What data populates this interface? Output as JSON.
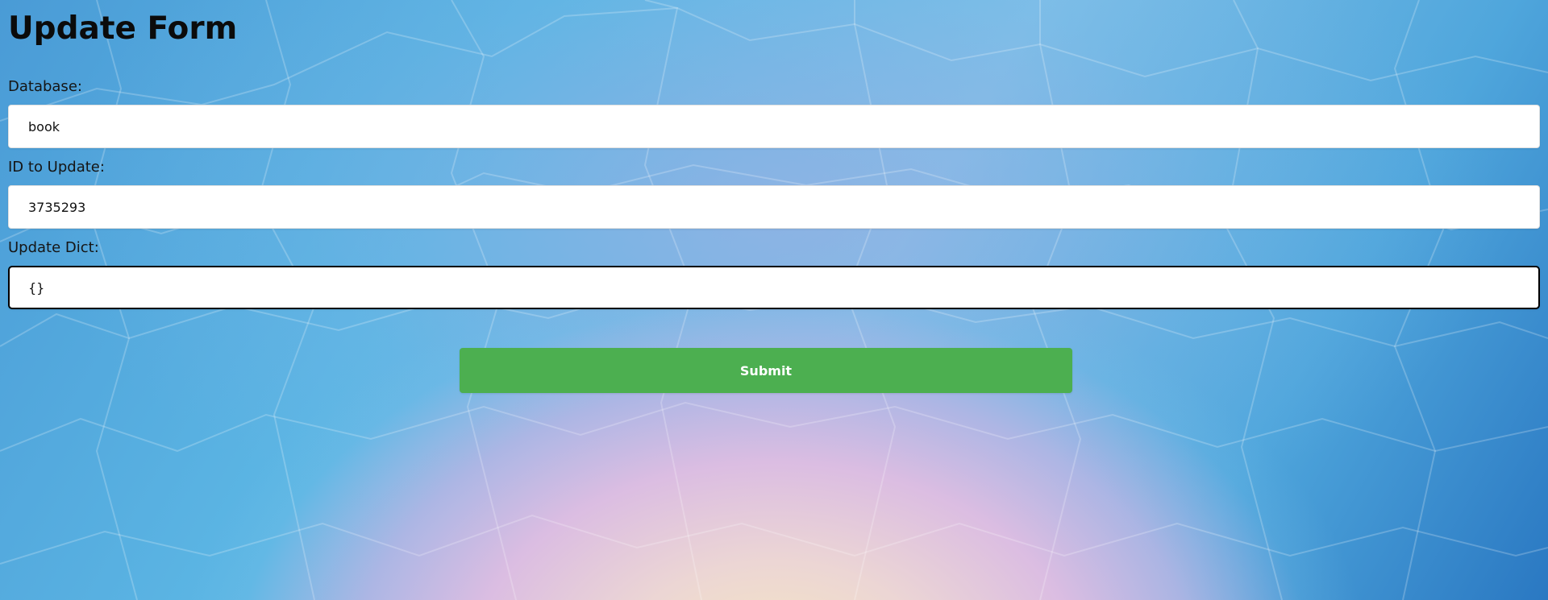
{
  "page": {
    "title": "Update Form"
  },
  "form": {
    "database": {
      "label": "Database:",
      "value": "book"
    },
    "id_to_update": {
      "label": "ID to Update:",
      "value": "3735293"
    },
    "update_dict": {
      "label": "Update Dict:",
      "value": "{}"
    },
    "submit_label": "Submit"
  },
  "colors": {
    "submit_button": "#4caf50",
    "focused_border": "#000000"
  }
}
